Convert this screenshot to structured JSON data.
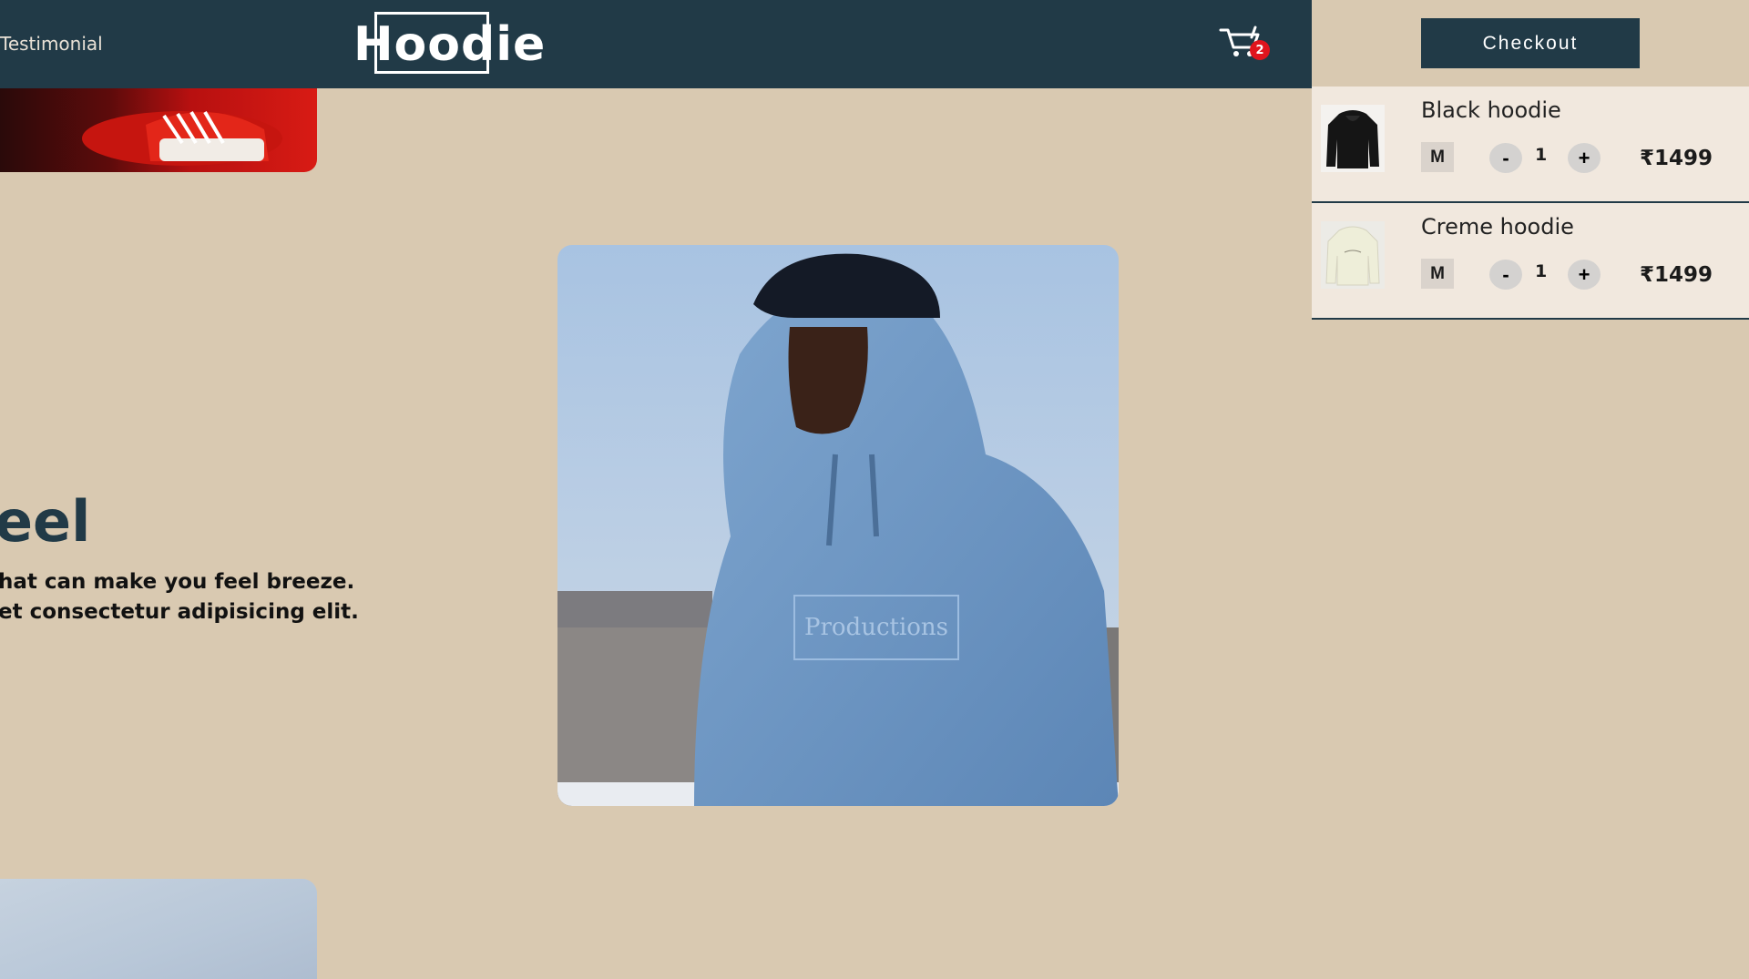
{
  "header": {
    "nav_testimonial": "Testimonial",
    "logo": "Hoodie",
    "cart_count": "2"
  },
  "hero": {
    "title": "eel",
    "line1": "hat can make you feel breeze.",
    "line2": "et consectetur adipisicing elit.",
    "image_name": "man-in-blue-hoodie-photo",
    "image_text": "Productions"
  },
  "cart": {
    "checkout_label": "Checkout",
    "items": [
      {
        "name": "Black hoodie",
        "size": "M",
        "quantity": "1",
        "minus": "-",
        "plus": "+",
        "price": "₹1499"
      },
      {
        "name": "Creme hoodie",
        "size": "M",
        "quantity": "1",
        "minus": "-",
        "plus": "+",
        "price": "₹1499"
      }
    ]
  },
  "colors": {
    "header_bg": "#213a47",
    "page_bg": "#d9c9b1",
    "cart_item_bg": "#f1e8de",
    "badge": "#e0141d"
  }
}
